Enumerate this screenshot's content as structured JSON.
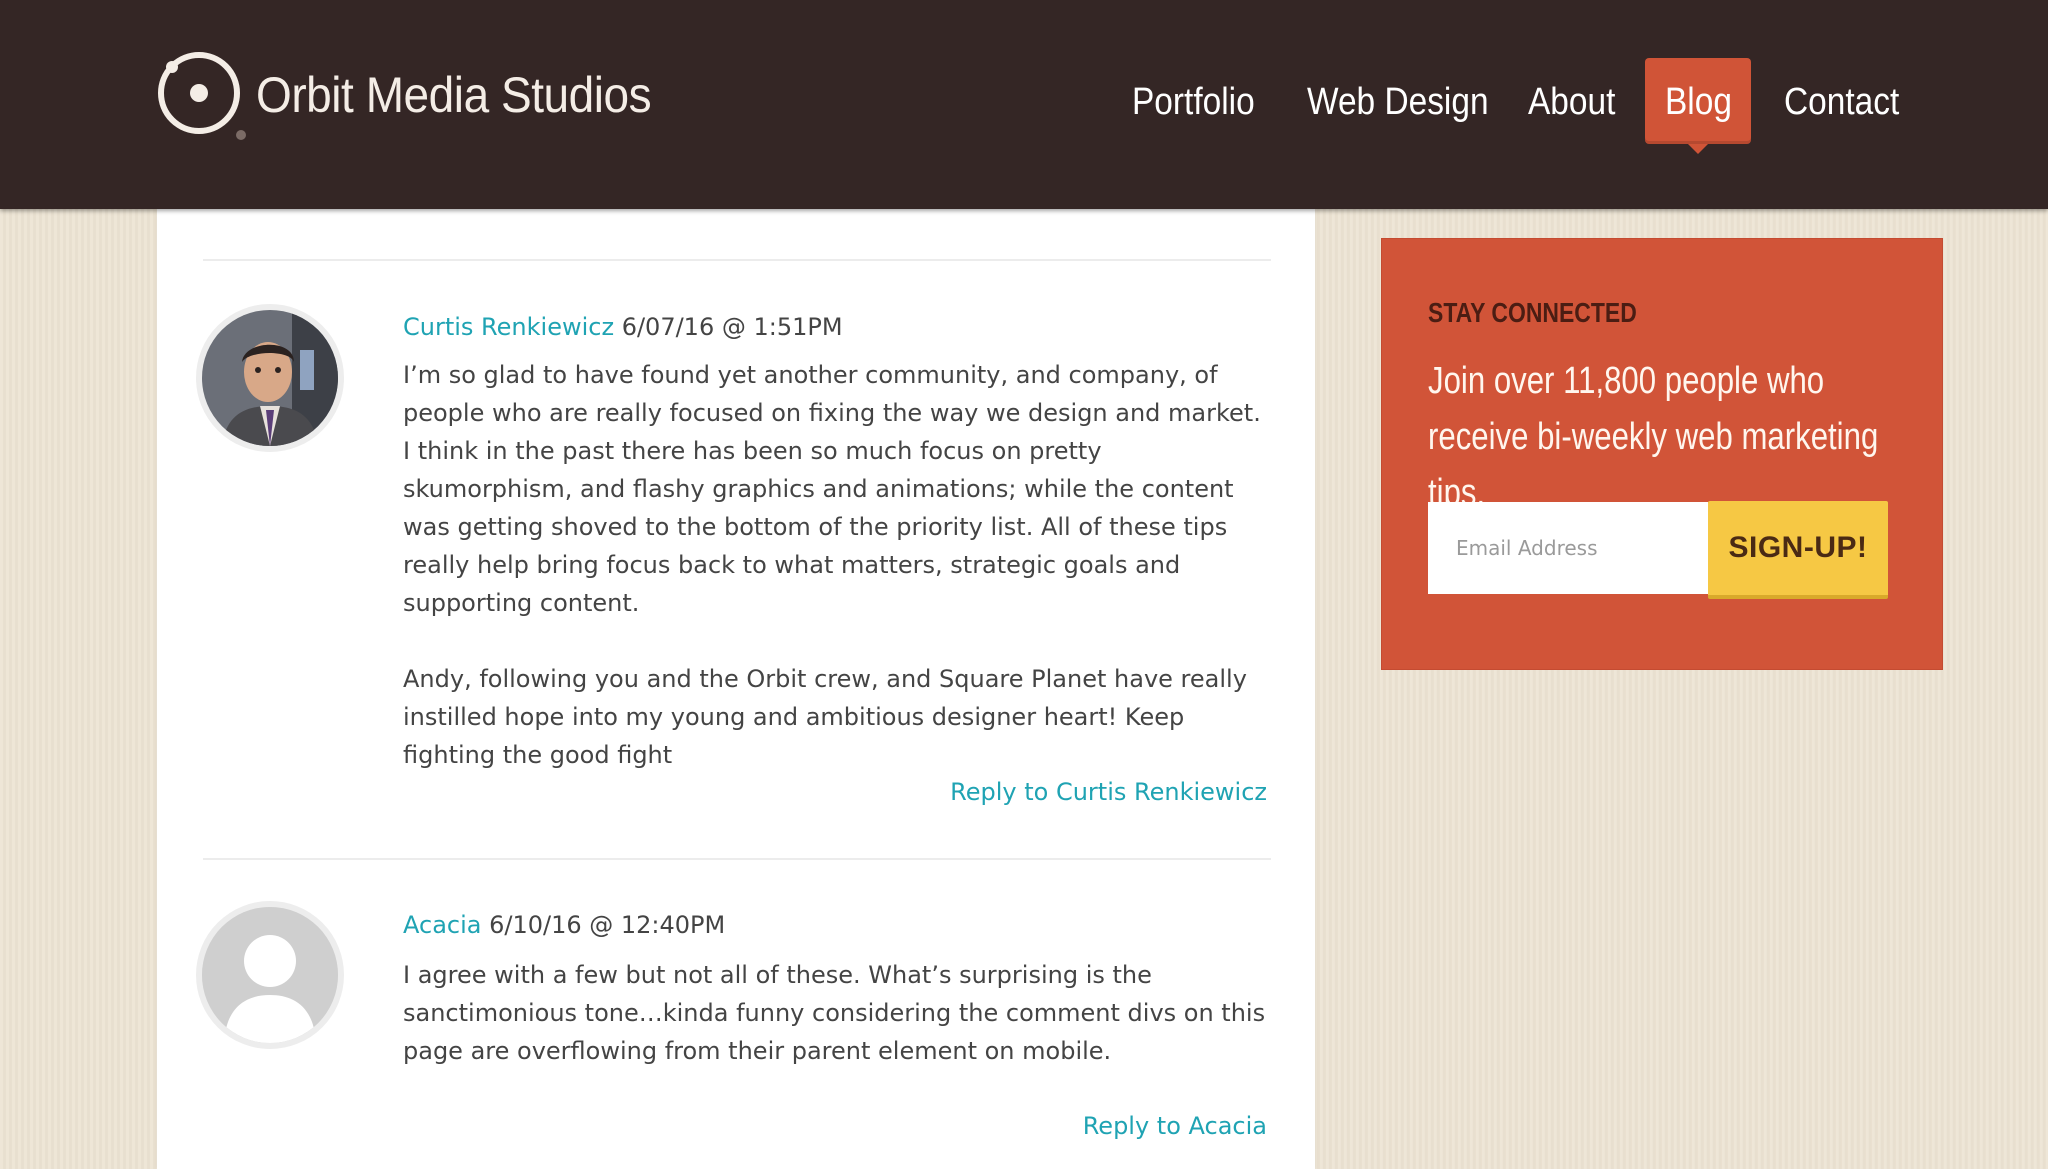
{
  "brand": {
    "name": "Orbit Media Studios"
  },
  "nav": {
    "items": [
      {
        "label": "Portfolio"
      },
      {
        "label": "Web Design"
      },
      {
        "label": "About"
      },
      {
        "label": "Blog",
        "active": true
      },
      {
        "label": "Contact"
      }
    ]
  },
  "comments": [
    {
      "author": "Curtis Renkiewicz",
      "date": "6/07/16 @ 1:51PM",
      "paragraphs": [
        "I’m so glad to have found yet another community, and company, of people who are really focused on fixing the way we design and market. I think in the past there has been so much focus on pretty skumorphism, and flashy graphics and animations; while the content was getting shoved to the bottom of the priority list. All of these tips really help bring focus back to what matters, strategic goals and supporting content.",
        "Andy, following you and the Orbit crew, and Square Planet have really instilled hope into my young and ambitious designer heart! Keep fighting the good fight"
      ],
      "reply": "Reply to Curtis Renkiewicz"
    },
    {
      "author": "Acacia",
      "date": "6/10/16 @ 12:40PM",
      "paragraphs": [
        "I agree with a few but not all of these. What’s surprising is the sanctimonious tone…kinda funny considering the comment divs on this page are overflowing from their parent element on mobile."
      ],
      "reply": "Reply to Acacia"
    }
  ],
  "signup": {
    "heading": "STAY CONNECTED",
    "text": "Join over 11,800 people who receive bi-weekly web marketing tips.",
    "email_placeholder": "Email Address",
    "email_value": "",
    "button_label": "SIGN-UP!"
  },
  "colors": {
    "header_bg": "#342625",
    "accent_red": "#d05437",
    "link_teal": "#1fa3b3",
    "button_yellow": "#f6c844",
    "page_bg": "#ece3d2"
  }
}
